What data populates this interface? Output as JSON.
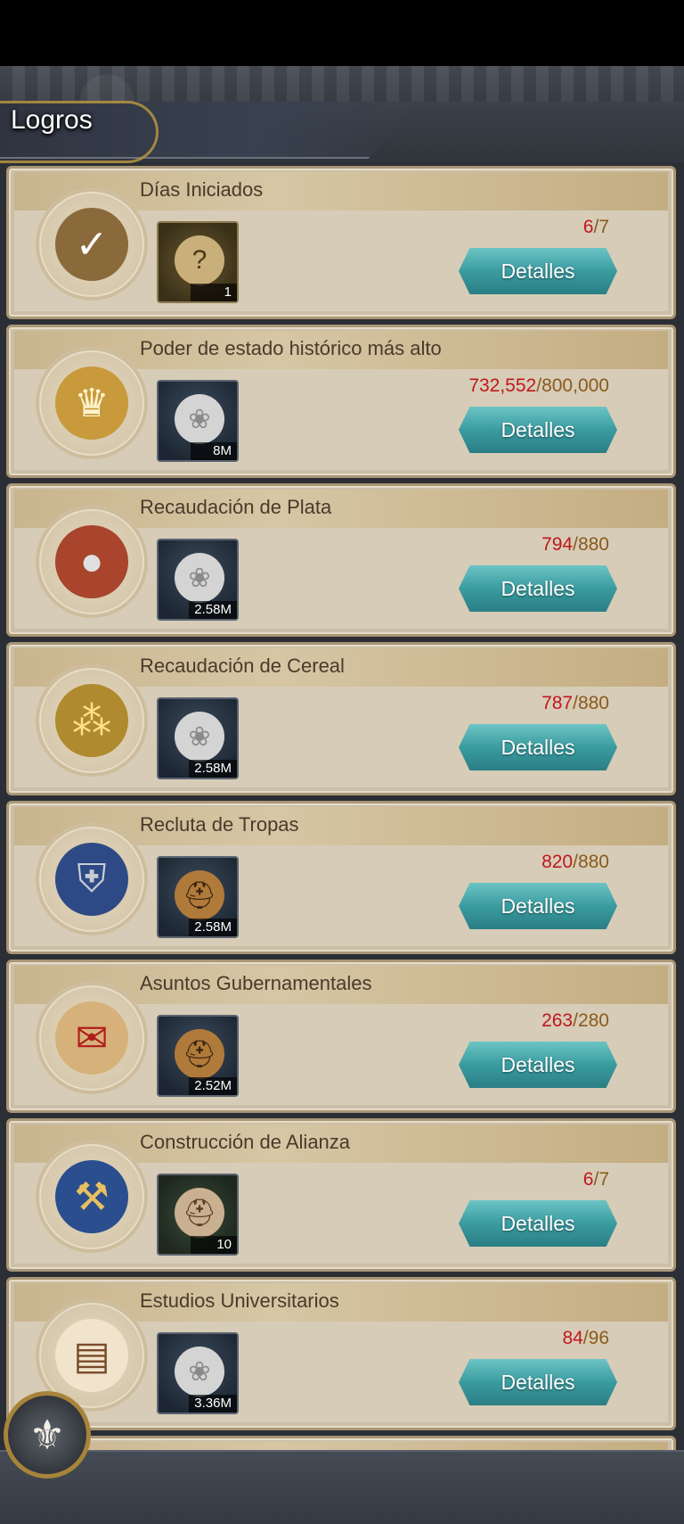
{
  "header": {
    "title": "Logros"
  },
  "details_label": "Detalles",
  "colors": {
    "progress_current": "#c0181e",
    "progress_max": "#8a5a1c",
    "button": "#3a9ca0"
  },
  "achievements": [
    {
      "title": "Días Iniciados",
      "icon": "contract-checkmark-icon",
      "reward_icon": "scroll-question-icon",
      "reward_count": "1",
      "current": "6",
      "max": "7"
    },
    {
      "title": "Poder de estado histórico más alto",
      "icon": "crown-icon",
      "reward_icon": "silver-coin-icon",
      "reward_count": "8M",
      "current": "732,552",
      "max": "800,000"
    },
    {
      "title": "Recaudación de Plata",
      "icon": "coin-sack-icon",
      "reward_icon": "silver-coin-icon",
      "reward_count": "2.58M",
      "current": "794",
      "max": "880"
    },
    {
      "title": "Recaudación de Cereal",
      "icon": "wheat-cart-icon",
      "reward_icon": "silver-coin-icon",
      "reward_count": "2.58M",
      "current": "787",
      "max": "880"
    },
    {
      "title": "Recluta de Tropas",
      "icon": "soldiers-icon",
      "reward_icon": "knight-helmet-icon",
      "reward_count": "2.58M",
      "current": "820",
      "max": "880"
    },
    {
      "title": "Asuntos Gubernamentales",
      "icon": "sealed-letter-icon",
      "reward_icon": "knight-helmet-icon",
      "reward_count": "2.52M",
      "current": "263",
      "max": "280"
    },
    {
      "title": "Construcción de Alianza",
      "icon": "alliance-banner-icon",
      "reward_icon": "helmet-scroll-icon",
      "reward_count": "10",
      "current": "6",
      "max": "7"
    },
    {
      "title": "Estudios Universitarios",
      "icon": "open-book-icon",
      "reward_icon": "silver-coin-icon",
      "reward_count": "3.36M",
      "current": "84",
      "max": "96"
    }
  ]
}
